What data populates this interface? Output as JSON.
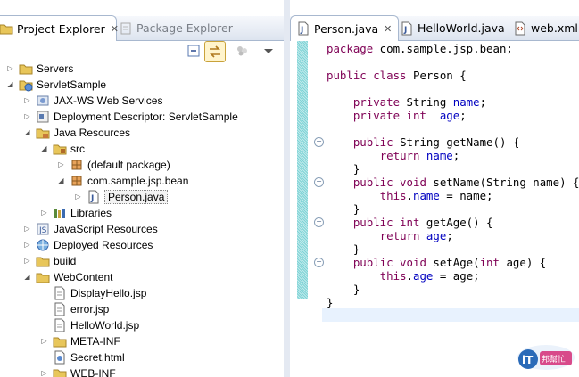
{
  "left_tabs": {
    "project_explorer": "Project Explorer",
    "project_explorer_close": "✕",
    "package_explorer": "Package Explorer"
  },
  "tree": [
    {
      "label": "Servers"
    },
    {
      "label": "ServletSample"
    },
    {
      "label": "JAX-WS Web Services"
    },
    {
      "label": "Deployment Descriptor: ServletSample"
    },
    {
      "label": "Java Resources"
    },
    {
      "label": "src"
    },
    {
      "label": "(default package)"
    },
    {
      "label": "com.sample.jsp.bean"
    },
    {
      "label": "Person.java"
    },
    {
      "label": "Libraries"
    },
    {
      "label": "JavaScript Resources"
    },
    {
      "label": "Deployed Resources"
    },
    {
      "label": "build"
    },
    {
      "label": "WebContent"
    },
    {
      "label": "DisplayHello.jsp"
    },
    {
      "label": "error.jsp"
    },
    {
      "label": "HelloWorld.jsp"
    },
    {
      "label": "META-INF"
    },
    {
      "label": "Secret.html"
    },
    {
      "label": "WEB-INF"
    }
  ],
  "editor_tabs": [
    {
      "label": "Person.java",
      "close": "✕"
    },
    {
      "label": "HelloWorld.java"
    },
    {
      "label": "web.xml"
    }
  ],
  "code": {
    "l1": {
      "kw": "package",
      "rest": " com.sample.jsp.bean;"
    },
    "l2": {
      "kw": "public class",
      "rest": " Person {"
    },
    "l3": {
      "kw": "private",
      "type": " String ",
      "field": "name",
      "end": ";"
    },
    "l4": {
      "kw": "private int",
      "field": "age",
      "end": ";"
    },
    "l5": {
      "kw": "public",
      "rest": " String getName() {"
    },
    "l6": {
      "kw": "return",
      "field": "name",
      "end": ";"
    },
    "l7": {
      "rest": "}"
    },
    "l8": {
      "kw": "public void",
      "rest": " setName(String name) {"
    },
    "l9": {
      "kw": "this",
      "dot": ".",
      "field": "name",
      "end": " = name;"
    },
    "l10": {
      "rest": "}"
    },
    "l11": {
      "kw": "public int",
      "rest": " getAge() {"
    },
    "l12": {
      "kw": "return",
      "field": "age",
      "end": ";"
    },
    "l13": {
      "rest": "}"
    },
    "l14": {
      "kw": "public void",
      "rest": " setAge(",
      "kw2": "int",
      "rest2": " age) {"
    },
    "l15": {
      "kw": "this",
      "dot": ".",
      "field": "age",
      "end": " = age;"
    },
    "l16": {
      "rest": "}"
    },
    "l17": {
      "rest": "}"
    }
  },
  "colors": {
    "keyword": "#7f0055",
    "field": "#0000c0",
    "ruler": "#7fd3d6",
    "tab_border": "#a8b8cf"
  },
  "watermark": {
    "text": "iT邦幫忙"
  }
}
